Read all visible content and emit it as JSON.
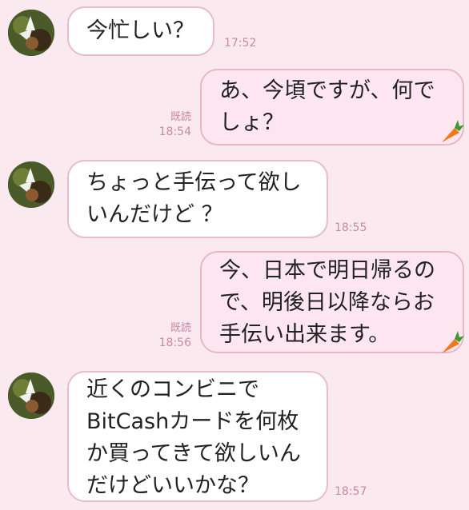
{
  "messages": [
    {
      "side": "in",
      "lines": [
        "今忙しい？"
      ],
      "time": "17:52"
    },
    {
      "side": "out",
      "lines": [
        "あ、今頃ですが、何で",
        "しょ？"
      ],
      "read": "既読",
      "time": "18:54"
    },
    {
      "side": "in",
      "lines": [
        "ちょっと手伝って欲し",
        "いんだけど ？"
      ],
      "time": "18:55"
    },
    {
      "side": "out",
      "lines": [
        "今、日本で明日帰るの",
        "で、明後日以降ならお",
        "手伝い出来ます。"
      ],
      "read": "既読",
      "time": "18:56"
    },
    {
      "side": "in",
      "lines": [
        "近くのコンビニで",
        "BitCashカードを何枚",
        "か買ってきて欲しいん",
        "だけどいいかな？"
      ],
      "time": "18:57"
    }
  ],
  "colors": {
    "background": "#fbe9f0",
    "bubble_in": "#ffffff",
    "bubble_out": "#fde6ef",
    "border": "#e7bccb",
    "meta": "#c98aa3"
  },
  "icons": {
    "avatar": "avatar-image",
    "sticker": "carrot-icon"
  }
}
